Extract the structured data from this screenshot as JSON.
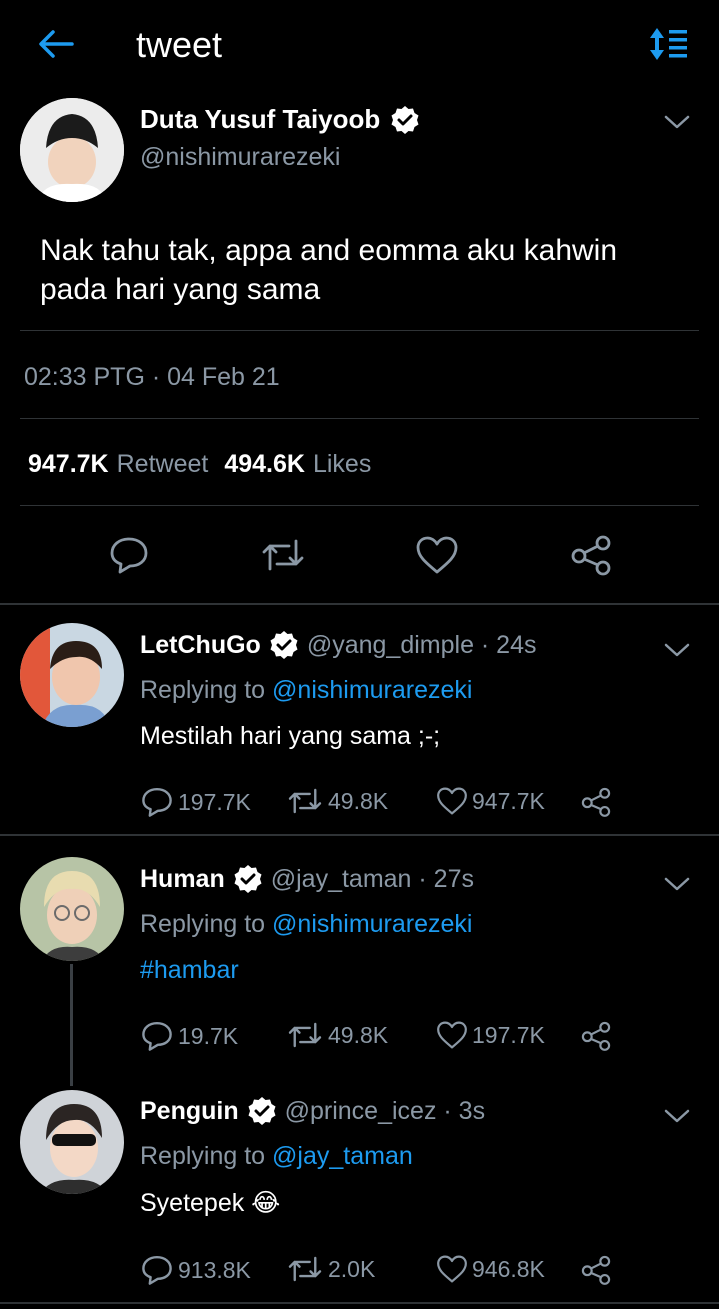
{
  "header": {
    "title": "tweet"
  },
  "main_tweet": {
    "author_name": "Duta Yusuf Taiyoob",
    "handle": "@nishimurarezeki",
    "text_line1": "Nak tahu tak, appa and eomma aku kahwin",
    "text_line2": "pada hari yang sama",
    "timestamp": "02:33 PTG · 04 Feb 21",
    "retweet_count": "947.7K",
    "retweet_label": "Retweet",
    "likes_count": "494.6K",
    "likes_label": "Likes"
  },
  "replies": [
    {
      "name": "LetChuGo",
      "handle": "@yang_dimple",
      "time": " · 24s",
      "replying_prefix": "Replying to ",
      "replying_to": "@nishimurarezeki",
      "text": "Mestilah hari yang sama ;-;",
      "reply_count": "197.7K",
      "retweet_count": "49.8K",
      "like_count": "947.7K"
    },
    {
      "name": "Human",
      "handle": "@jay_taman",
      "time": " · 27s",
      "replying_prefix": "Replying to ",
      "replying_to": "@nishimurarezeki",
      "text": "#hambar",
      "reply_count": "19.7K",
      "retweet_count": "49.8K",
      "like_count": "197.7K"
    },
    {
      "name": "Penguin",
      "handle": "@prince_icez",
      "time": " · 3s",
      "replying_prefix": "Replying to ",
      "replying_to": "@jay_taman",
      "text": "Syetepek 😂",
      "reply_count": "913.8K",
      "retweet_count": "2.0K",
      "like_count": "946.8K"
    }
  ],
  "colors": {
    "accent": "#1d9bf0",
    "background": "#000000",
    "muted": "#8b98a5"
  }
}
